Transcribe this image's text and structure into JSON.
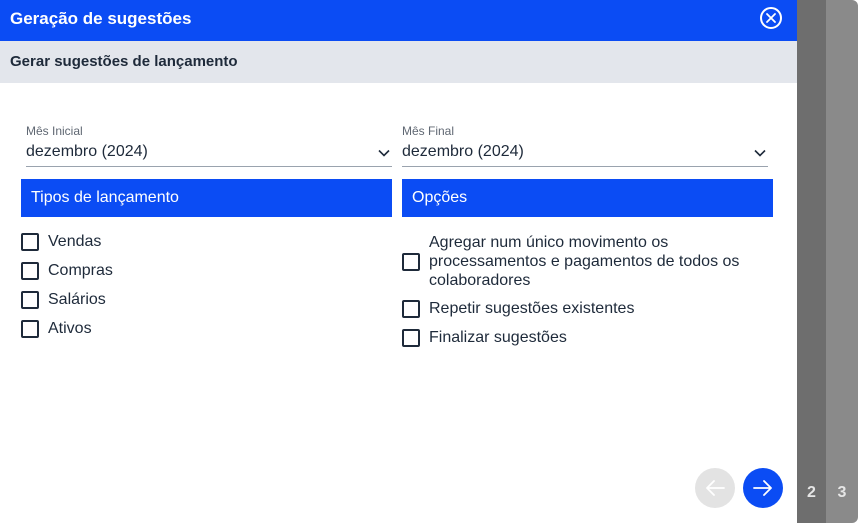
{
  "dialog": {
    "title": "Geração de sugestões",
    "subtitle": "Gerar sugestões de lançamento"
  },
  "fields": {
    "start_month": {
      "label": "Mês Inicial",
      "value": "dezembro (2024)"
    },
    "end_month": {
      "label": "Mês Final",
      "value": "dezembro (2024)"
    }
  },
  "sections": {
    "types": {
      "heading": "Tipos de lançamento",
      "items": [
        {
          "label": "Vendas",
          "checked": false
        },
        {
          "label": "Compras",
          "checked": false
        },
        {
          "label": "Salários",
          "checked": false
        },
        {
          "label": "Ativos",
          "checked": false
        }
      ]
    },
    "options": {
      "heading": "Opções",
      "items": [
        {
          "label": "Agregar num único movimento os processamentos e pagamentos de todos os colaboradores",
          "checked": false
        },
        {
          "label": "Repetir sugestões existentes",
          "checked": false
        },
        {
          "label": "Finalizar sugestões",
          "checked": false
        }
      ]
    }
  },
  "stack": {
    "page_2": "2",
    "page_3": "3"
  },
  "colors": {
    "accent": "#0b4cf4",
    "subheader_bg": "#e3e6ec",
    "disabled_btn": "#e3e3e3"
  }
}
